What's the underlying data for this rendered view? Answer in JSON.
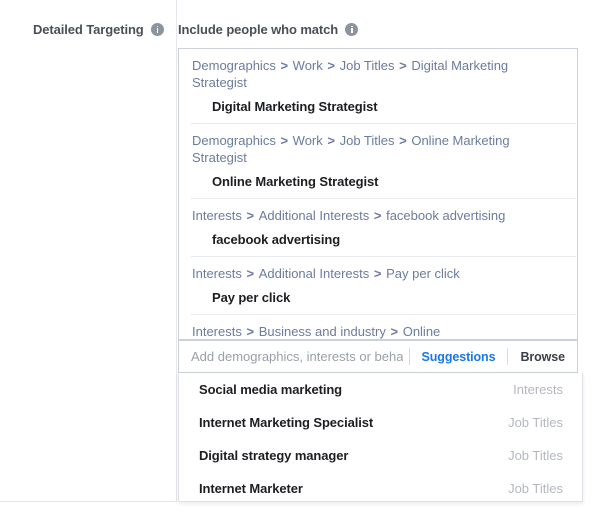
{
  "form": {
    "label": "Detailed Targeting",
    "label_info_icon": "info-icon",
    "sub_label": "Include people who match",
    "sub_label_info_icon": "info-icon"
  },
  "selected": {
    "items": [
      {
        "breadcrumb": [
          "Demographics",
          "Work",
          "Job Titles",
          "Digital Marketing Strategist"
        ],
        "name": "Digital Marketing Strategist"
      },
      {
        "breadcrumb": [
          "Demographics",
          "Work",
          "Job Titles",
          "Online Marketing Strategist"
        ],
        "name": "Online Marketing Strategist"
      },
      {
        "breadcrumb": [
          "Interests",
          "Additional Interests",
          "facebook advertising"
        ],
        "name": "facebook advertising"
      },
      {
        "breadcrumb": [
          "Interests",
          "Additional Interests",
          "Pay per click"
        ],
        "name": "Pay per click"
      },
      {
        "breadcrumb": [
          "Interests",
          "Business and industry",
          "Online"
        ],
        "name": ""
      }
    ],
    "separator": ">"
  },
  "search": {
    "value": "",
    "placeholder": "Add demographics, interests or behaviors",
    "suggestions_label": "Suggestions",
    "browse_label": "Browse"
  },
  "suggestions": {
    "items": [
      {
        "label": "Social media marketing",
        "category": "Interests"
      },
      {
        "label": "Internet Marketing Specialist",
        "category": "Job Titles"
      },
      {
        "label": "Digital strategy manager",
        "category": "Job Titles"
      },
      {
        "label": "Internet Marketer",
        "category": "Job Titles"
      }
    ]
  },
  "colors": {
    "breadcrumb_blue": "#6b7c9e",
    "link_blue": "#1877f2",
    "text_dark": "#1c1e21",
    "muted": "#b4b8be",
    "border": "#ccd0d9"
  }
}
